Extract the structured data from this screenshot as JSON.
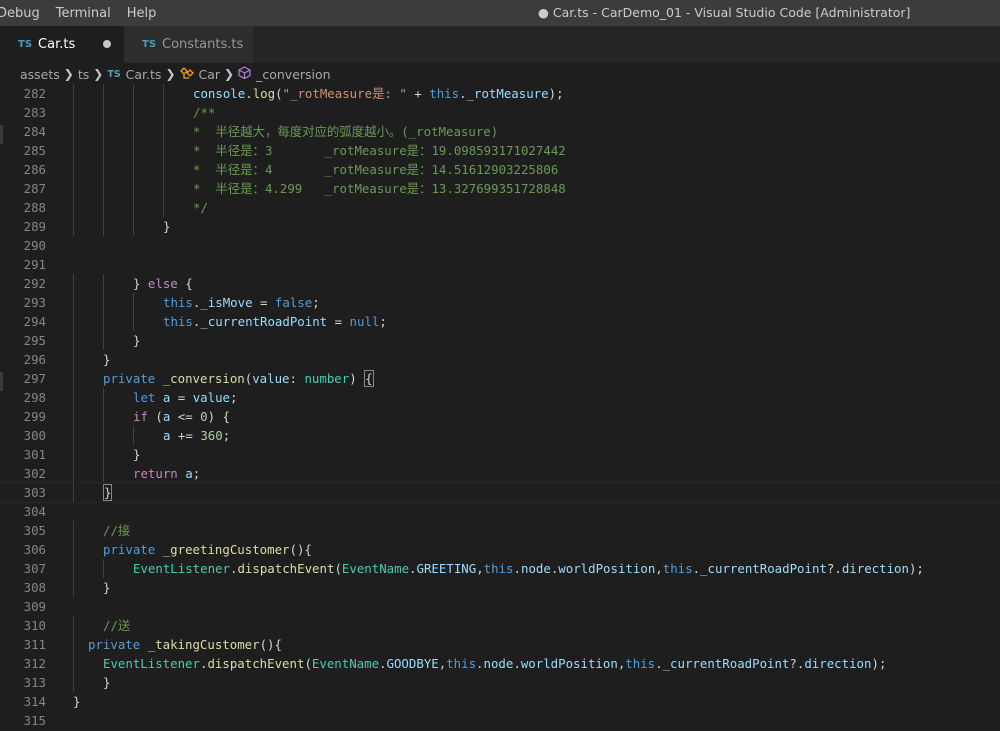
{
  "menu": [
    "Debug",
    "Terminal",
    "Help"
  ],
  "window_title": "● Car.ts - CarDemo_01 - Visual Studio Code [Administrator]",
  "tabs": [
    {
      "badge": "TS",
      "label": "Car.ts",
      "modified": true
    },
    {
      "badge": "TS",
      "label": "Constants.ts",
      "modified": false
    }
  ],
  "breadcrumb": [
    "assets",
    "ts",
    "Car.ts",
    "Car",
    "_conversion"
  ],
  "breadcrumb_ts_badge": "TS",
  "colors": {
    "keyword": "#569cd6",
    "control": "#c586c0",
    "function": "#dcdcaa",
    "variable": "#9cdcfe",
    "string": "#ce9178",
    "number": "#b5cea8",
    "comment": "#6a9955",
    "type": "#4ec9b0",
    "plain": "#d4d4d4"
  },
  "lines": [
    {
      "n": 282,
      "indent": 16,
      "tokens": [
        [
          "fn-var",
          "console"
        ],
        [
          "pl",
          "."
        ],
        [
          "fn",
          "log"
        ],
        [
          "pl",
          "("
        ],
        [
          "str",
          "\"_rotMeasure是: \""
        ],
        [
          "pl",
          " + "
        ],
        [
          "kw",
          "this"
        ],
        [
          "pl",
          "."
        ],
        [
          "var",
          "_rotMeasure"
        ],
        [
          "pl",
          ");"
        ]
      ]
    },
    {
      "n": 283,
      "indent": 16,
      "tokens": [
        [
          "cmt",
          "/**"
        ]
      ]
    },
    {
      "n": 284,
      "indent": 16,
      "tokens": [
        [
          "cmt",
          "*  半径越大，每度对应的弧度越小。(_rotMeasure)"
        ]
      ]
    },
    {
      "n": 285,
      "indent": 16,
      "tokens": [
        [
          "cmt",
          "*  半径是：3       _rotMeasure是：19.098593171027442"
        ]
      ]
    },
    {
      "n": 286,
      "indent": 16,
      "tokens": [
        [
          "cmt",
          "*  半径是：4       _rotMeasure是：14.51612903225806"
        ]
      ]
    },
    {
      "n": 287,
      "indent": 16,
      "tokens": [
        [
          "cmt",
          "*  半径是：4.299   _rotMeasure是：13.327699351728848"
        ]
      ]
    },
    {
      "n": 288,
      "indent": 16,
      "tokens": [
        [
          "cmt",
          "*/"
        ]
      ]
    },
    {
      "n": 289,
      "indent": 12,
      "tokens": [
        [
          "pl",
          "}"
        ]
      ]
    },
    {
      "n": 290,
      "indent": 0,
      "tokens": []
    },
    {
      "n": 291,
      "indent": 0,
      "tokens": []
    },
    {
      "n": 292,
      "indent": 8,
      "tokens": [
        [
          "pl",
          "} "
        ],
        [
          "ctl",
          "else"
        ],
        [
          "pl",
          " {"
        ]
      ]
    },
    {
      "n": 293,
      "indent": 12,
      "tokens": [
        [
          "kw",
          "this"
        ],
        [
          "pl",
          "."
        ],
        [
          "var",
          "_isMove"
        ],
        [
          "pl",
          " = "
        ],
        [
          "kw",
          "false"
        ],
        [
          "pl",
          ";"
        ]
      ]
    },
    {
      "n": 294,
      "indent": 12,
      "tokens": [
        [
          "kw",
          "this"
        ],
        [
          "pl",
          "."
        ],
        [
          "var",
          "_currentRoadPoint"
        ],
        [
          "pl",
          " = "
        ],
        [
          "kw",
          "null"
        ],
        [
          "pl",
          ";"
        ]
      ]
    },
    {
      "n": 295,
      "indent": 8,
      "tokens": [
        [
          "pl",
          "}"
        ]
      ]
    },
    {
      "n": 296,
      "indent": 4,
      "tokens": [
        [
          "pl",
          "}"
        ]
      ]
    },
    {
      "n": 297,
      "indent": 4,
      "tokens": [
        [
          "kw",
          "private"
        ],
        [
          "pl",
          " "
        ],
        [
          "fn",
          "_conversion"
        ],
        [
          "pl",
          "("
        ],
        [
          "var",
          "value"
        ],
        [
          "pl",
          ": "
        ],
        [
          "type",
          "number"
        ],
        [
          "pl",
          ") "
        ],
        [
          "box",
          "{"
        ]
      ]
    },
    {
      "n": 298,
      "indent": 8,
      "tokens": [
        [
          "kw",
          "let"
        ],
        [
          "pl",
          " "
        ],
        [
          "var",
          "a"
        ],
        [
          "pl",
          " = "
        ],
        [
          "var",
          "value"
        ],
        [
          "pl",
          ";"
        ]
      ]
    },
    {
      "n": 299,
      "indent": 8,
      "tokens": [
        [
          "ctl",
          "if"
        ],
        [
          "pl",
          " ("
        ],
        [
          "var",
          "a"
        ],
        [
          "pl",
          " <= "
        ],
        [
          "num",
          "0"
        ],
        [
          "pl",
          ") {"
        ]
      ]
    },
    {
      "n": 300,
      "indent": 12,
      "tokens": [
        [
          "var",
          "a"
        ],
        [
          "pl",
          " += "
        ],
        [
          "num",
          "360"
        ],
        [
          "pl",
          ";"
        ]
      ]
    },
    {
      "n": 301,
      "indent": 8,
      "tokens": [
        [
          "pl",
          "}"
        ]
      ]
    },
    {
      "n": 302,
      "indent": 8,
      "tokens": [
        [
          "ctl",
          "return"
        ],
        [
          "pl",
          " "
        ],
        [
          "var",
          "a"
        ],
        [
          "pl",
          ";"
        ]
      ]
    },
    {
      "n": 303,
      "indent": 4,
      "tokens": [
        [
          "box",
          "}"
        ]
      ],
      "current": true
    },
    {
      "n": 304,
      "indent": 0,
      "tokens": []
    },
    {
      "n": 305,
      "indent": 4,
      "tokens": [
        [
          "cmt",
          "//接"
        ]
      ]
    },
    {
      "n": 306,
      "indent": 4,
      "tokens": [
        [
          "kw",
          "private"
        ],
        [
          "pl",
          " "
        ],
        [
          "fn",
          "_greetingCustomer"
        ],
        [
          "pl",
          "(){"
        ]
      ]
    },
    {
      "n": 307,
      "indent": 8,
      "tokens": [
        [
          "type",
          "EventListener"
        ],
        [
          "pl",
          "."
        ],
        [
          "fn",
          "dispatchEvent"
        ],
        [
          "pl",
          "("
        ],
        [
          "type",
          "EventName"
        ],
        [
          "pl",
          "."
        ],
        [
          "var",
          "GREETING"
        ],
        [
          "pl",
          ","
        ],
        [
          "kw",
          "this"
        ],
        [
          "pl",
          "."
        ],
        [
          "var",
          "node"
        ],
        [
          "pl",
          "."
        ],
        [
          "var",
          "worldPosition"
        ],
        [
          "pl",
          ","
        ],
        [
          "kw",
          "this"
        ],
        [
          "pl",
          "."
        ],
        [
          "var",
          "_currentRoadPoint"
        ],
        [
          "pl",
          "?."
        ],
        [
          "var",
          "direction"
        ],
        [
          "pl",
          ");"
        ]
      ]
    },
    {
      "n": 308,
      "indent": 4,
      "tokens": [
        [
          "pl",
          "}"
        ]
      ]
    },
    {
      "n": 309,
      "indent": 0,
      "tokens": []
    },
    {
      "n": 310,
      "indent": 4,
      "tokens": [
        [
          "cmt",
          "//送"
        ]
      ]
    },
    {
      "n": 311,
      "indent": 2,
      "tokens": [
        [
          "kw",
          "private"
        ],
        [
          "pl",
          " "
        ],
        [
          "fn",
          "_takingCustomer"
        ],
        [
          "pl",
          "(){"
        ]
      ]
    },
    {
      "n": 312,
      "indent": 4,
      "tokens": [
        [
          "type",
          "EventListener"
        ],
        [
          "pl",
          "."
        ],
        [
          "fn",
          "dispatchEvent"
        ],
        [
          "pl",
          "("
        ],
        [
          "type",
          "EventName"
        ],
        [
          "pl",
          "."
        ],
        [
          "var",
          "GOODBYE"
        ],
        [
          "pl",
          ","
        ],
        [
          "kw",
          "this"
        ],
        [
          "pl",
          "."
        ],
        [
          "var",
          "node"
        ],
        [
          "pl",
          "."
        ],
        [
          "var",
          "worldPosition"
        ],
        [
          "pl",
          ","
        ],
        [
          "kw",
          "this"
        ],
        [
          "pl",
          "."
        ],
        [
          "var",
          "_currentRoadPoint"
        ],
        [
          "pl",
          "?."
        ],
        [
          "var",
          "direction"
        ],
        [
          "pl",
          ");"
        ]
      ]
    },
    {
      "n": 313,
      "indent": 4,
      "tokens": [
        [
          "pl",
          "}"
        ]
      ]
    },
    {
      "n": 314,
      "indent": 0,
      "tokens": [
        [
          "pl",
          "}"
        ]
      ]
    },
    {
      "n": 315,
      "indent": 0,
      "tokens": []
    }
  ]
}
